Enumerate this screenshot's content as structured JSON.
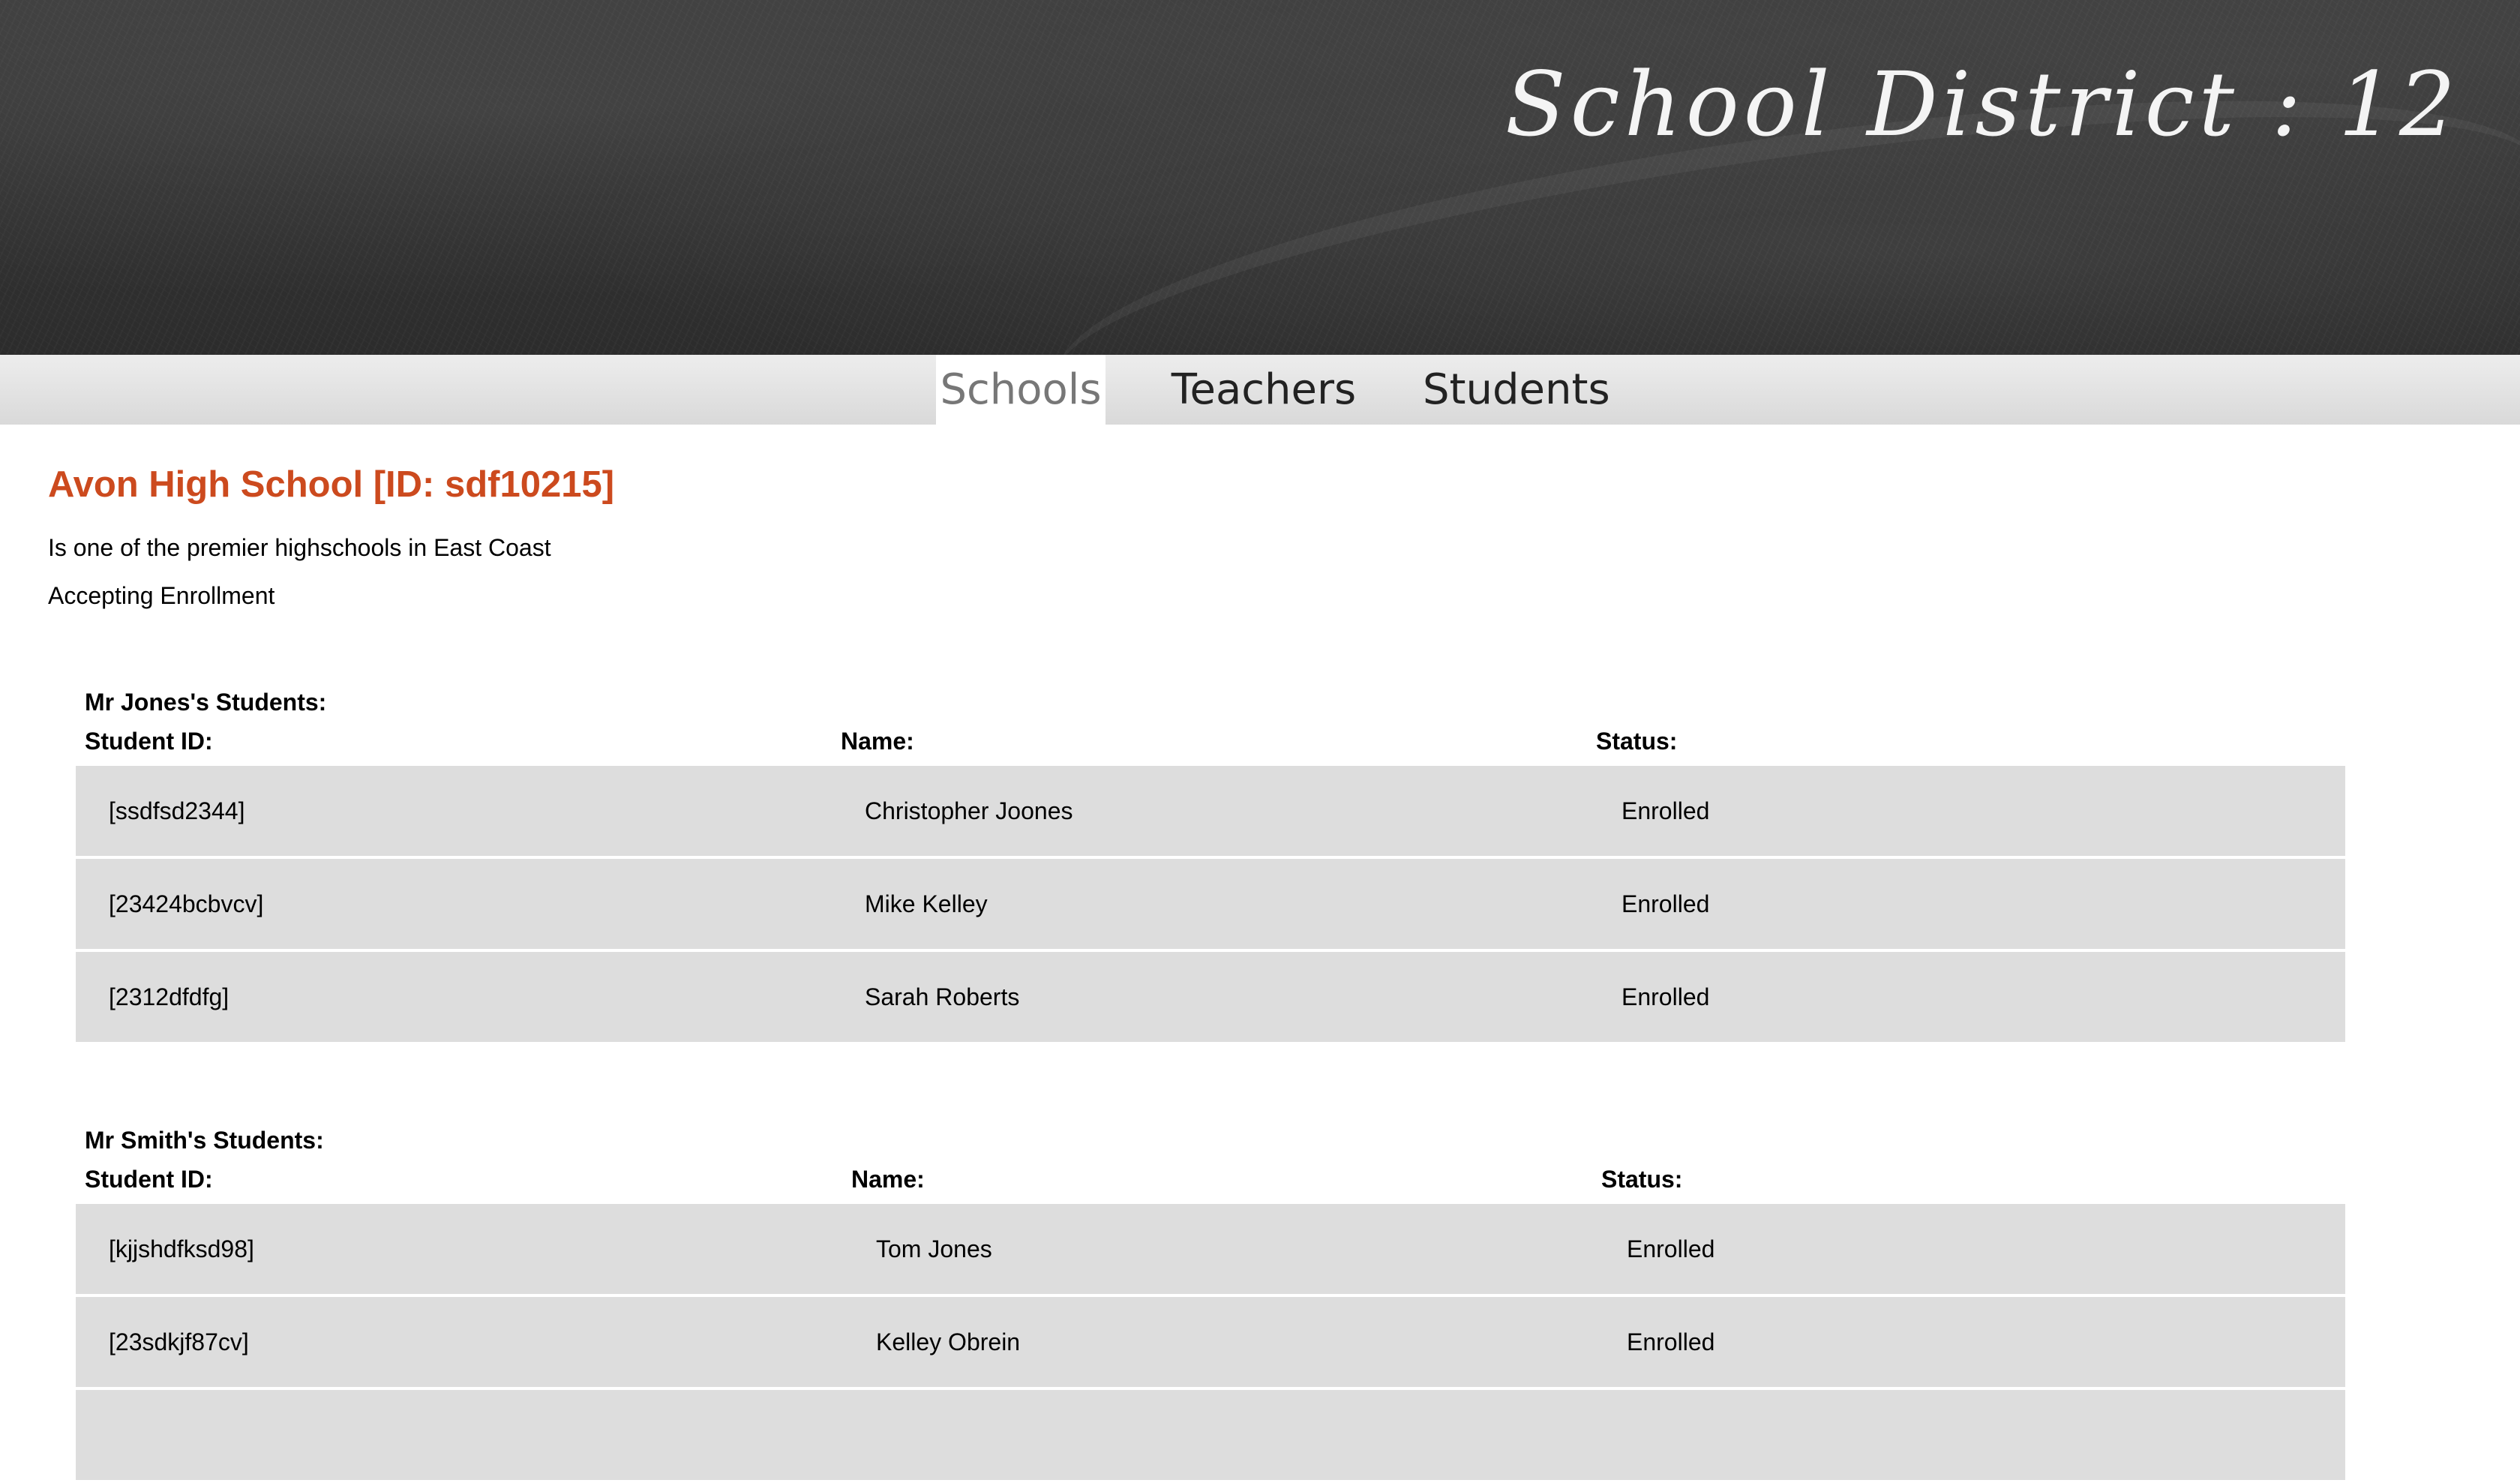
{
  "site": {
    "title": "School District : 12"
  },
  "nav": {
    "tabs": [
      {
        "label": "Schools",
        "active": true
      },
      {
        "label": "Teachers",
        "active": false
      },
      {
        "label": "Students",
        "active": false
      }
    ]
  },
  "school": {
    "title": "Avon High School [ID: sdf10215]",
    "description": "Is one of the premier highschools in East Coast",
    "status": "Accepting Enrollment"
  },
  "columns": {
    "id": "Student ID:",
    "name": "Name:",
    "status": "Status:"
  },
  "teachers": [
    {
      "heading": "Mr Jones's Students:",
      "students": [
        {
          "id": "[ssdfsd2344]",
          "name": "Christopher Joones",
          "status": "Enrolled"
        },
        {
          "id": "[23424bcbvcv]",
          "name": "Mike Kelley",
          "status": "Enrolled"
        },
        {
          "id": "[2312dfdfg]",
          "name": "Sarah Roberts",
          "status": "Enrolled"
        }
      ]
    },
    {
      "heading": "Mr Smith's Students:",
      "students": [
        {
          "id": "[kjjshdfksd98]",
          "name": "Tom Jones",
          "status": "Enrolled"
        },
        {
          "id": "[23sdkjf87cv]",
          "name": "Kelley Obrein",
          "status": "Enrolled"
        }
      ]
    }
  ],
  "colors": {
    "accent": "#cc4a1e",
    "row_background": "#dddddd",
    "header_background": "#333333"
  }
}
